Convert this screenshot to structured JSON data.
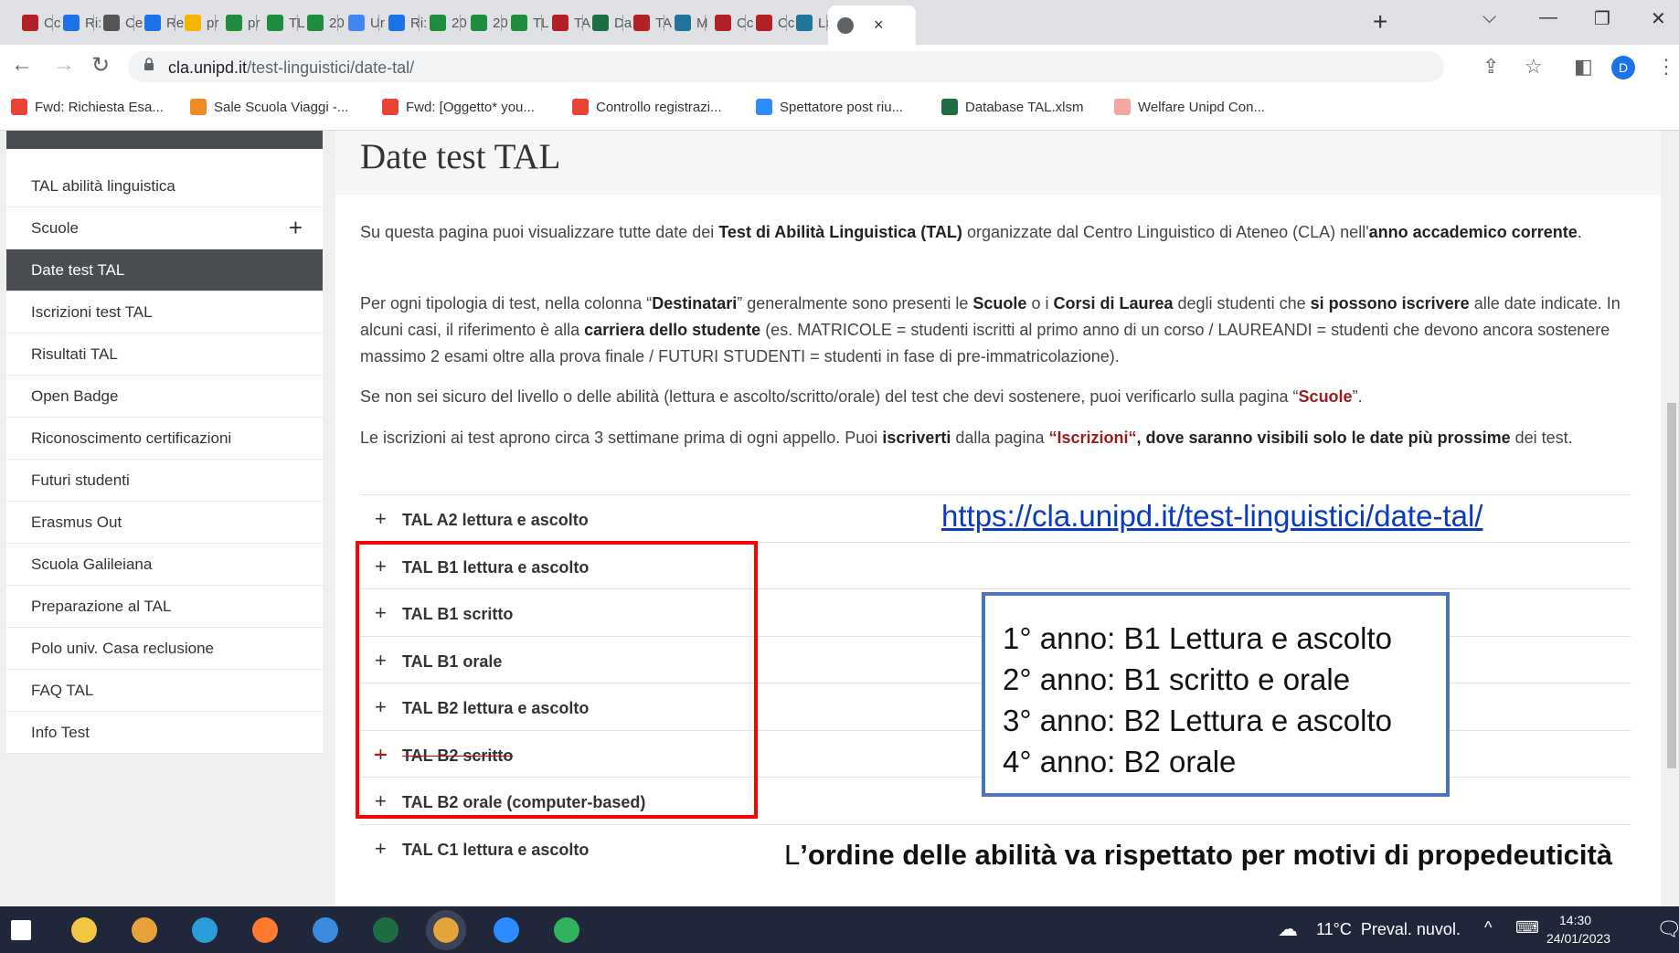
{
  "browser": {
    "tabs": [
      {
        "label": "Cc",
        "icon": "unipd-shield-icon",
        "color": "#b32025"
      },
      {
        "label": "Ri:",
        "icon": "google-drive-icon",
        "color": "#1a73e8"
      },
      {
        "label": "Ce",
        "icon": "chrome-globe-icon",
        "color": "#555555"
      },
      {
        "label": "Re",
        "icon": "google-drive-icon",
        "color": "#1a73e8"
      },
      {
        "label": "pr",
        "icon": "google-slides-icon",
        "color": "#f4b400"
      },
      {
        "label": "pr",
        "icon": "google-forms-cross-icon",
        "color": "#1e8e3e"
      },
      {
        "label": "TL",
        "icon": "google-forms-cross-icon",
        "color": "#1e8e3e"
      },
      {
        "label": "20",
        "icon": "google-forms-cross-icon",
        "color": "#1e8e3e"
      },
      {
        "label": "Ur",
        "icon": "calendar-icon",
        "color": "#4285f4"
      },
      {
        "label": "Ri:",
        "icon": "google-drive-icon",
        "color": "#1a73e8"
      },
      {
        "label": "20",
        "icon": "google-forms-cross-icon",
        "color": "#1e8e3e"
      },
      {
        "label": "20",
        "icon": "google-forms-cross-icon",
        "color": "#1e8e3e"
      },
      {
        "label": "TL",
        "icon": "google-forms-cross-icon",
        "color": "#1e8e3e"
      },
      {
        "label": "TA",
        "icon": "unipd-shield-icon",
        "color": "#b32025"
      },
      {
        "label": "Da",
        "icon": "excel-icon",
        "color": "#1d6f42"
      },
      {
        "label": "TA",
        "icon": "unipd-shield-icon",
        "color": "#b32025"
      },
      {
        "label": "M",
        "icon": "wordpress-icon",
        "color": "#21759b"
      },
      {
        "label": "Cc",
        "icon": "unipd-shield-icon",
        "color": "#b32025"
      },
      {
        "label": "Cc",
        "icon": "unipd-shield-icon",
        "color": "#b32025"
      },
      {
        "label": "Lc",
        "icon": "wordpress-icon",
        "color": "#21759b"
      }
    ],
    "active_tab_icon": "chrome-globe-icon",
    "active_tab_close": "×",
    "new_tab": "+",
    "url_host": "cla.unipd.it",
    "url_path": "/test-linguistici/date-tal/",
    "profile_initial": "D",
    "bookmarks": [
      {
        "label": "Fwd: Richiesta Esa...",
        "icon": "gmail-icon",
        "color": "#ea4335"
      },
      {
        "label": "Sale Scuola Viaggi -...",
        "icon": "vlc-cone-icon",
        "color": "#f08a24"
      },
      {
        "label": "Fwd: [Oggetto* you...",
        "icon": "gmail-icon",
        "color": "#ea4335"
      },
      {
        "label": "Controllo registrazi...",
        "icon": "gmail-icon",
        "color": "#ea4335"
      },
      {
        "label": "Spettatore post riu...",
        "icon": "zoom-icon",
        "color": "#2d8cff"
      },
      {
        "label": "Database TAL.xlsm",
        "icon": "excel-icon",
        "color": "#1d6f42"
      },
      {
        "label": "Welfare Unipd Con...",
        "icon": "welfare-icon",
        "color": "#f4a6a0"
      }
    ]
  },
  "sidebar": {
    "items": [
      {
        "label": "TAL abilità linguistica"
      },
      {
        "label": "Scuole",
        "expand": "+"
      },
      {
        "label": "Date test TAL",
        "active": true
      },
      {
        "label": "Iscrizioni test TAL"
      },
      {
        "label": "Risultati TAL"
      },
      {
        "label": "Open Badge"
      },
      {
        "label": "Riconoscimento certificazioni"
      },
      {
        "label": "Futuri studenti"
      },
      {
        "label": "Erasmus Out"
      },
      {
        "label": "Scuola Galileiana"
      },
      {
        "label": "Preparazione al TAL"
      },
      {
        "label": "Polo univ. Casa reclusione"
      },
      {
        "label": "FAQ TAL"
      },
      {
        "label": "Info Test"
      }
    ]
  },
  "main": {
    "title": "Date test TAL",
    "para1": {
      "a": "Su questa pagina puoi visualizzare tutte date dei ",
      "b": "Test di Abilità Linguistica (TAL)",
      "c": " organizzate dal Centro Linguistico di Ateneo (CLA) nell'",
      "d": "anno accademico corrente",
      "e": "."
    },
    "para2": {
      "a": "Per ogni tipologia di test, nella colonna “",
      "b": "Destinatari",
      "c": "” generalmente sono presenti le ",
      "d": "Scuole",
      "e": " o i ",
      "f": "Corsi di Laurea",
      "g": " degli studenti che ",
      "h": "si possono iscrivere",
      "i": " alle date indicate. In alcuni casi, il riferimento è alla ",
      "j": "carriera dello studente",
      "k": " (es. MATRICOLE = studenti iscritti al primo anno di un corso / LAUREANDI = studenti che devono ancora sostenere massimo 2 esami oltre alla prova finale / FUTURI STUDENTI = studenti in fase di pre-immatricolazione)."
    },
    "para3": {
      "a": "Se non sei sicuro del livello o delle abilità (lettura e ascolto/scritto/orale) del test che devi sostenere, puoi verificarlo sulla pagina “",
      "b": "Scuole",
      "c": "”."
    },
    "para4": {
      "a": "Le iscrizioni ai test aprono circa 3 settimane prima di ogni appello. Puoi ",
      "b": "iscriverti",
      "c": " dalla pagina ",
      "d": "“Iscrizioni“",
      "e": ", dove saranno ",
      "f": "visibili solo le date più prossime",
      "g": " dei test."
    },
    "accordion": [
      {
        "label": "TAL A2 lettura e ascolto"
      },
      {
        "label": "TAL B1 lettura e ascolto"
      },
      {
        "label": "TAL B1 scritto"
      },
      {
        "label": "TAL B1 orale"
      },
      {
        "label": "TAL B2 lettura e ascolto"
      },
      {
        "label": "TAL B2 scritto",
        "struck": true
      },
      {
        "label": "TAL B2 orale (computer-based)"
      },
      {
        "label": "TAL C1 lettura e ascolto"
      }
    ],
    "accordion_symbol": "+"
  },
  "annotations": {
    "url": "https://cla.unipd.it/test-linguistici/date-tal/",
    "years": [
      "1° anno: B1 Lettura e ascolto",
      "2° anno: B1 scritto e orale",
      "3° anno: B2 Lettura e ascolto",
      "4° anno: B2 orale"
    ],
    "note_prefix": "L",
    "note_bold": "’ordine delle abilità va rispettato per motivi di propedeuticità",
    "red_box_color": "#ff0000",
    "blue_box_color": "#4a73b8"
  },
  "taskbar": {
    "apps": [
      "windows-start-icon",
      "file-explorer-icon",
      "chrome-icon",
      "edge-icon",
      "firefox-icon",
      "internet-explorer-icon",
      "excel-icon",
      "chrome-active-icon",
      "zoom-icon",
      "green-app-icon"
    ],
    "weather": "11°C  Preval. nuvol.",
    "time": "14:30",
    "date": "24/01/2023"
  }
}
